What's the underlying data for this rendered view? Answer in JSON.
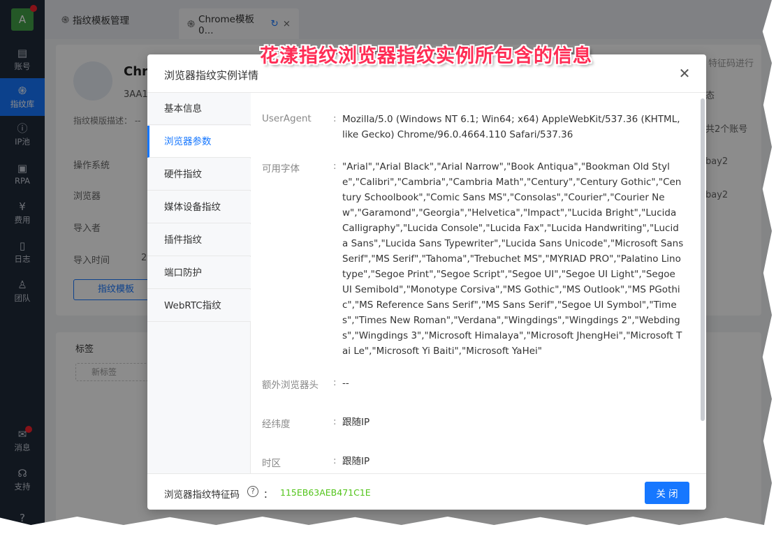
{
  "sidebar": {
    "avatar_letter": "A",
    "items": [
      {
        "label": "账号",
        "icon": "id-card-icon"
      },
      {
        "label": "指纹库",
        "icon": "fingerprint-icon"
      },
      {
        "label": "IP池",
        "icon": "ip-icon"
      },
      {
        "label": "RPA",
        "icon": "robot-icon"
      },
      {
        "label": "费用",
        "icon": "yen-icon"
      },
      {
        "label": "日志",
        "icon": "document-icon"
      },
      {
        "label": "团队",
        "icon": "team-icon"
      }
    ],
    "bottom_items": [
      {
        "label": "消息",
        "icon": "mail-icon"
      },
      {
        "label": "支持",
        "icon": "headset-icon"
      }
    ]
  },
  "tabs": [
    {
      "label": "指纹模板管理"
    },
    {
      "label": "Chrome模板0..."
    }
  ],
  "background": {
    "title_partial": "Chr",
    "id_partial": "3AA1",
    "desc_label": "指纹模版描述： --",
    "os_label": "操作系统",
    "browser_label": "浏览器",
    "importer_label": "导入者",
    "import_time_label": "导入时间",
    "import_time_partial": "2",
    "template_btn": "指纹模板",
    "tags_label": "标签",
    "new_tag": "新标签",
    "right_header": "态",
    "right_btn": "特征码进行",
    "right_count": "共2个账号",
    "right_row1": "bay2",
    "right_row2": "bay2"
  },
  "modal": {
    "title": "浏览器指纹实例详情",
    "menu": [
      "基本信息",
      "浏览器参数",
      "硬件指纹",
      "媒体设备指纹",
      "插件指纹",
      "端口防护",
      "WebRTC指纹"
    ],
    "active_menu": 1,
    "fields": [
      {
        "label": "UserAgent",
        "value": "Mozilla/5.0 (Windows NT 6.1; Win64; x64) AppleWebKit/537.36 (KHTML, like Gecko) Chrome/96.0.4664.110 Safari/537.36"
      },
      {
        "label": "可用字体",
        "value": "\"Arial\",\"Arial Black\",\"Arial Narrow\",\"Book Antiqua\",\"Bookman Old Style\",\"Calibri\",\"Cambria\",\"Cambria Math\",\"Century\",\"Century Gothic\",\"Century Schoolbook\",\"Comic Sans MS\",\"Consolas\",\"Courier\",\"Courier New\",\"Garamond\",\"Georgia\",\"Helvetica\",\"Impact\",\"Lucida Bright\",\"Lucida Calligraphy\",\"Lucida Console\",\"Lucida Fax\",\"Lucida Handwriting\",\"Lucida Sans\",\"Lucida Sans Typewriter\",\"Lucida Sans Unicode\",\"Microsoft Sans Serif\",\"MS Serif\",\"Tahoma\",\"Trebuchet MS\",\"MYRIAD PRO\",\"Palatino Linotype\",\"Segoe Print\",\"Segoe Script\",\"Segoe UI\",\"Segoe UI Light\",\"Segoe UI Semibold\",\"Monotype Corsiva\",\"MS Gothic\",\"MS Outlook\",\"MS PGothic\",\"MS Reference Sans Serif\",\"MS Sans Serif\",\"Segoe UI Symbol\",\"Times\",\"Times New Roman\",\"Verdana\",\"Wingdings\",\"Wingdings 2\",\"Webdings\",\"Wingdings 3\",\"Microsoft Himalaya\",\"Microsoft JhengHei\",\"Microsoft Tai Le\",\"Microsoft Yi Baiti\",\"Microsoft YaHei\""
      },
      {
        "label": "额外浏览器头",
        "value": "--"
      },
      {
        "label": "经纬度",
        "value": "跟随IP"
      },
      {
        "label": "时区",
        "value": "跟随IP"
      }
    ],
    "footer": {
      "fp_label": "浏览器指纹特征码",
      "colon": "：",
      "fp_code": "115EB63AEB471C1E",
      "close_label": "关 闭"
    }
  },
  "annotation": "花漾指纹浏览器指纹实例所包含的信息",
  "colors": {
    "accent": "#1677ff",
    "sidebar_bg": "#1f2a3a",
    "code_green": "#52c41a",
    "annotation_red": "#ff2d55"
  }
}
